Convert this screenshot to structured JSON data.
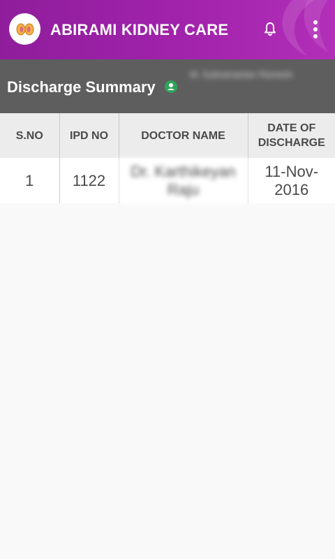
{
  "app": {
    "title": "ABIRAMI KIDNEY CARE",
    "brand_color": "#9b22a6",
    "icons": {
      "logo": "kidney-logo-icon",
      "notifications": "bell-icon",
      "menu": "more-vert-icon"
    }
  },
  "subheader": {
    "title": "Discharge Summary",
    "status_icon": "user-status-icon",
    "status_color": "#2fa35a",
    "user_name": "M. Subramanian Ramesh"
  },
  "table": {
    "headers": {
      "sno": "S.NO",
      "ipd_no": "IPD NO",
      "doctor_name": "DOCTOR NAME",
      "discharge_date": "DATE OF DISCHARGE"
    },
    "rows": [
      {
        "sno": "1",
        "ipd_no": "1122",
        "doctor_name": "Dr. Karthikeyan Raju",
        "discharge_date": "11-Nov-2016"
      }
    ]
  }
}
